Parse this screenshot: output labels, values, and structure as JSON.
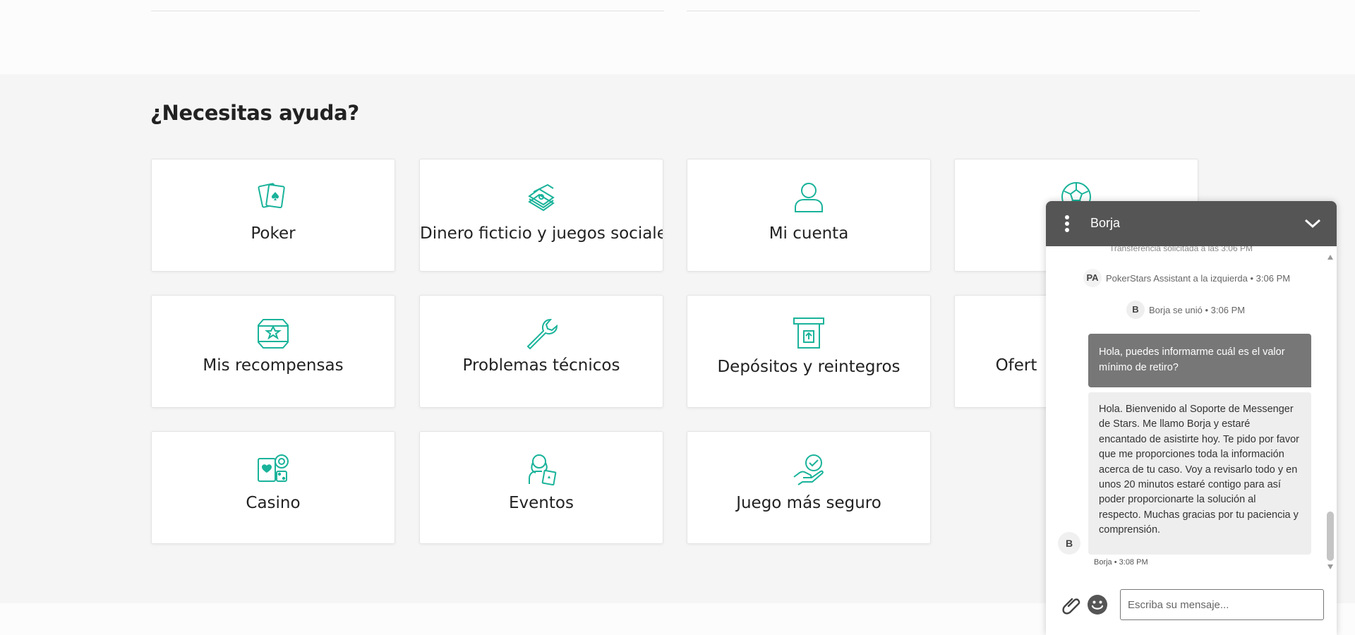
{
  "help": {
    "title": "¿Necesitas ayuda?",
    "cards": [
      {
        "label": "Poker",
        "icon": "poker-cards-icon"
      },
      {
        "label": "Dinero ficticio y juegos sociales",
        "icon": "money-stack-icon"
      },
      {
        "label": "Mi cuenta",
        "icon": "user-icon"
      },
      {
        "label": "",
        "icon": "soccer-ball-icon"
      },
      {
        "label": "Mis recompensas",
        "icon": "star-chest-icon"
      },
      {
        "label": "Problemas técnicos",
        "icon": "wrench-icon"
      },
      {
        "label": "Depósitos y reintegros",
        "icon": "atm-withdraw-icon"
      },
      {
        "label": "Ofert",
        "icon": "offers-icon"
      },
      {
        "label": "Casino",
        "icon": "casino-chips-icon"
      },
      {
        "label": "Eventos",
        "icon": "event-person-card-icon"
      },
      {
        "label": "Juego más seguro",
        "icon": "hand-check-icon"
      }
    ]
  },
  "chat": {
    "agent_name": "Borja",
    "cut_text": "Transferencia solicitada a las 3:06 PM",
    "system_messages": [
      {
        "badge": "PA",
        "text": "PokerStars Assistant a la izquierda • 3:06 PM"
      },
      {
        "badge": "B",
        "text": "Borja se unió • 3:06 PM"
      }
    ],
    "user_message": "Hola, puedes informarme cuál es el valor mínimo de retiro?",
    "agent_message": "Hola. Bienvenido al Soporte de Messenger de Stars. Me llamo Borja y estaré encantado de asistirte hoy. Te pido por favor que me proporciones toda la información acerca de tu caso. Voy a revisarlo todo y en unos 20 minutos estaré contigo para así poder proporcionarte la solución al respecto. Muchas gracias por tu paciencia y comprensión.",
    "agent_avatar": "B",
    "agent_meta": "Borja • 3:08 PM",
    "input_placeholder": "Escriba su mensaje...",
    "header_color": "#555555",
    "user_bubble_color": "#777777"
  },
  "colors": {
    "accent": "#1ab39a",
    "section_bg": "#f5f5f5"
  }
}
